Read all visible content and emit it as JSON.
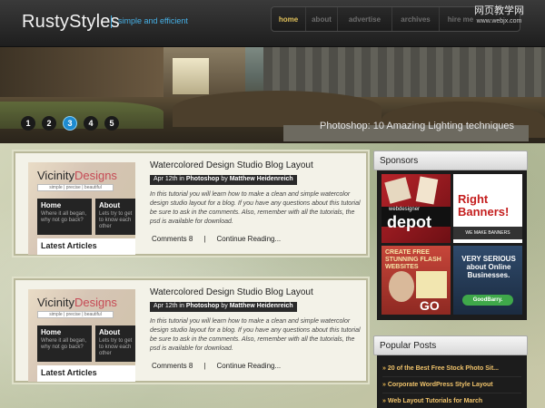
{
  "header": {
    "logo": "RustyStyles",
    "tagline": "simple and efficient",
    "nav": [
      "home",
      "about",
      "advertise",
      "archives",
      "hire me"
    ],
    "active_nav": "home",
    "watermark_main": "网页教学网",
    "watermark_sub": "www.webjx.com"
  },
  "hero": {
    "slides": [
      "1",
      "2",
      "3",
      "4",
      "5"
    ],
    "active_slide": "3",
    "caption": "Photoshop: 10 Amazing Lighting techniques"
  },
  "posts": [
    {
      "thumb_logo_a": "Vicinity",
      "thumb_logo_b": "Designs",
      "thumb_sub": "simple | precise | beautiful",
      "thumb_box1_title": "Home",
      "thumb_box1_text": "Where it all began, why not go back?",
      "thumb_box2_title": "About",
      "thumb_box2_text": "Lets try to get to know each other",
      "thumb_footer": "Latest Articles",
      "title": "Watercolored Design Studio Blog Layout",
      "meta_date": "Apr 12th in",
      "meta_category": "Photoshop",
      "meta_by": "by",
      "meta_author": "Matthew Heidenreich",
      "excerpt": "In this tutorial you will learn how to make a clean and simple watercolor design studio layout for a blog. If you have any questions about this tutorial be sure to ask in the comments. Also, remember with all the tutorials, the psd is available for download.",
      "comments": "Comments 8",
      "separator": "|",
      "continue": "Continue Reading..."
    },
    {
      "thumb_logo_a": "Vicinity",
      "thumb_logo_b": "Designs",
      "thumb_sub": "simple | precise | beautiful",
      "thumb_box1_title": "Home",
      "thumb_box1_text": "Where it all began, why not go back?",
      "thumb_box2_title": "About",
      "thumb_box2_text": "Lets try to get to know each other",
      "thumb_footer": "Latest Articles",
      "title": "Watercolored Design Studio Blog Layout",
      "meta_date": "Apr 12th in",
      "meta_category": "Photoshop",
      "meta_by": "by",
      "meta_author": "Matthew Heidenreich",
      "excerpt": "In this tutorial you will learn how to make a clean and simple watercolor design studio layout for a blog. If you have any questions about this tutorial be sure to ask in the comments. Also, remember with all the tutorials, the psd is available for download.",
      "comments": "Comments 8",
      "separator": "|",
      "continue": "Continue Reading..."
    }
  ],
  "sidebar": {
    "sponsors_title": "Sponsors",
    "ads": {
      "ad1_small": "webdesigner",
      "ad1_big": "depot",
      "ad2_line1": "Right",
      "ad2_line2": "Banners!",
      "ad2_bar": "WE MAKE BANNERS",
      "ad3_top": "CREATE FREE STUNNING FLASH WEBSITES",
      "ad3_go": "GO",
      "ad4_text": "VERY SERIOUS about Online Businesses.",
      "ad4_button": "GoodBarry."
    },
    "popular_title": "Popular Posts",
    "popular": [
      "20 of the Best Free Stock Photo Sit...",
      "Corporate WordPress Style Layout",
      "Web Layout Tutorials for March"
    ]
  },
  "colors": {
    "accent_blue": "#1d8bd0",
    "nav_active": "#e0c05a",
    "popular_link": "#f0c36b"
  }
}
